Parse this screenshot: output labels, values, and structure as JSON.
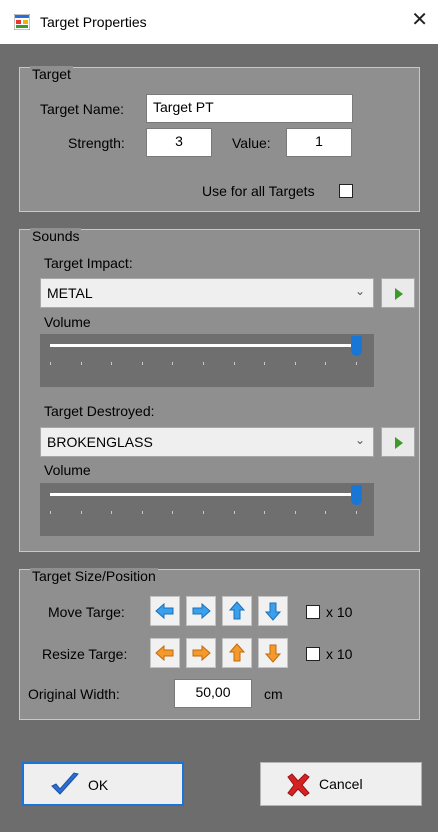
{
  "window": {
    "title": "Target Properties",
    "close_glyph": "✕"
  },
  "target_group": {
    "title": "Target",
    "name_label": "Target Name:",
    "name_value": "Target PT",
    "strength_label": "Strength:",
    "strength_value": "3",
    "value_label": "Value:",
    "value_value": "1",
    "use_all_label": "Use for all Targets",
    "use_all_checked": false
  },
  "sounds_group": {
    "title": "Sounds",
    "impact_label": "Target Impact:",
    "impact_selected": "METAL",
    "impact_volume_label": "Volume",
    "impact_volume_fraction": 1.0,
    "destroyed_label": "Target Destroyed:",
    "destroyed_selected": "BROKENGLASS",
    "destroyed_volume_label": "Volume",
    "destroyed_volume_fraction": 1.0
  },
  "size_group": {
    "title": "Target Size/Position",
    "move_label": "Move Targe:",
    "resize_label": "Resize Targe:",
    "x10_label": "x 10",
    "orig_width_label": "Original Width:",
    "orig_width_value": "50,00",
    "unit": "cm"
  },
  "buttons": {
    "ok_label": "OK",
    "cancel_label": "Cancel"
  },
  "colors": {
    "move_arrow": "#3aa0ee",
    "resize_arrow": "#f59a2a",
    "ok_check": "#2a6fd6",
    "cancel_x": "#d62222"
  }
}
